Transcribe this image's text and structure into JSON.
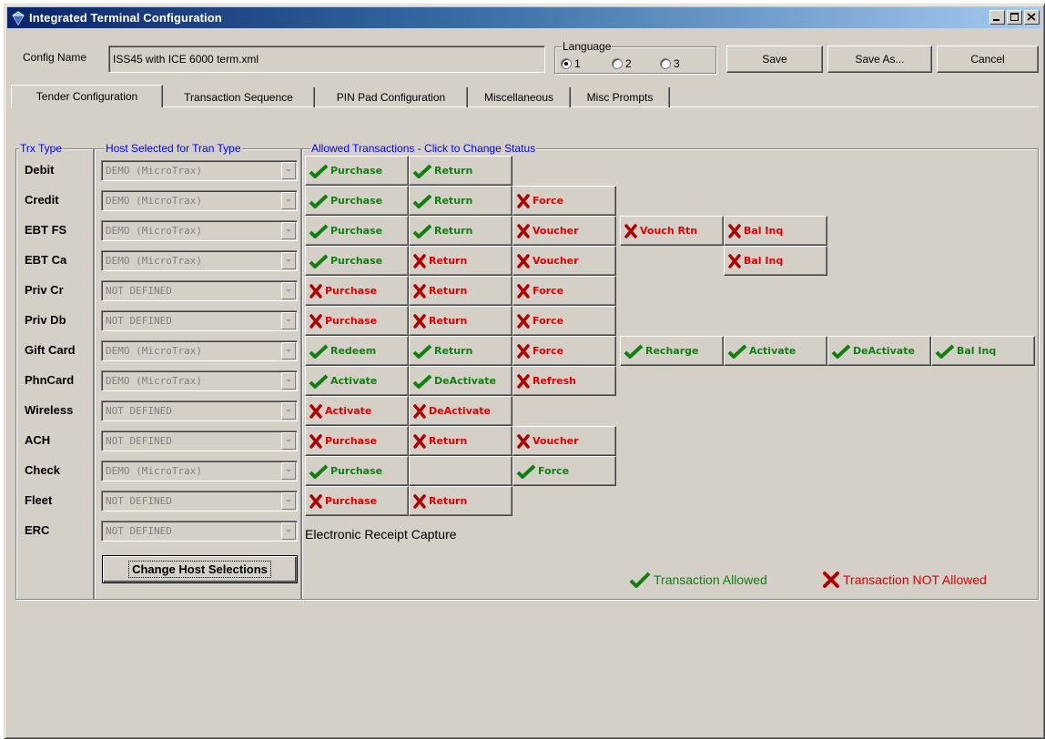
{
  "window": {
    "title": "Integrated Terminal Configuration"
  },
  "config": {
    "label": "Config Name",
    "value": "ISS45 with ICE 6000 term.xml"
  },
  "language": {
    "label": "Language",
    "options": [
      "1",
      "2",
      "3"
    ],
    "selected": "1"
  },
  "buttons": {
    "save": "Save",
    "save_as": "Save As...",
    "cancel": "Cancel",
    "change_hosts": "Change Host Selections"
  },
  "tabs": [
    "Tender Configuration",
    "Transaction Sequence",
    "PIN Pad Configuration",
    "Miscellaneous",
    "Misc Prompts"
  ],
  "active_tab": "Tender Configuration",
  "columns": {
    "trx_type": "Trx Type",
    "host": "Host Selected for Tran Type",
    "allowed": "Allowed Transactions - Click to Change Status"
  },
  "rows": [
    {
      "label": "Debit",
      "host": "DEMO (MicroTrax)",
      "trx": [
        {
          "name": "Purchase",
          "allowed": true
        },
        {
          "name": "Return",
          "allowed": true
        }
      ]
    },
    {
      "label": "Credit",
      "host": "DEMO (MicroTrax)",
      "trx": [
        {
          "name": "Purchase",
          "allowed": true
        },
        {
          "name": "Return",
          "allowed": true
        },
        {
          "name": "Force",
          "allowed": false
        }
      ]
    },
    {
      "label": "EBT FS",
      "host": "DEMO (MicroTrax)",
      "trx": [
        {
          "name": "Purchase",
          "allowed": true
        },
        {
          "name": "Return",
          "allowed": true
        },
        {
          "name": "Voucher",
          "allowed": false
        },
        {
          "name": "Vouch Rtn",
          "allowed": false
        },
        {
          "name": "Bal Inq",
          "allowed": false
        }
      ]
    },
    {
      "label": "EBT Ca",
      "host": "DEMO (MicroTrax)",
      "trx": [
        {
          "name": "Purchase",
          "allowed": true
        },
        {
          "name": "Return",
          "allowed": false
        },
        {
          "name": "Voucher",
          "allowed": false
        },
        null,
        {
          "name": "Bal Inq",
          "allowed": false
        }
      ]
    },
    {
      "label": "Priv Cr",
      "host": "NOT DEFINED",
      "trx": [
        {
          "name": "Purchase",
          "allowed": false
        },
        {
          "name": "Return",
          "allowed": false
        },
        {
          "name": "Force",
          "allowed": false
        }
      ]
    },
    {
      "label": "Priv Db",
      "host": "NOT DEFINED",
      "trx": [
        {
          "name": "Purchase",
          "allowed": false
        },
        {
          "name": "Return",
          "allowed": false
        },
        {
          "name": "Force",
          "allowed": false
        }
      ]
    },
    {
      "label": "Gift Card",
      "host": "DEMO (MicroTrax)",
      "trx": [
        {
          "name": "Redeem",
          "allowed": true
        },
        {
          "name": "Return",
          "allowed": true
        },
        {
          "name": "Force",
          "allowed": false
        },
        {
          "name": "Recharge",
          "allowed": true
        },
        {
          "name": "Activate",
          "allowed": true
        },
        {
          "name": "DeActivate",
          "allowed": true
        },
        {
          "name": "Bal Inq",
          "allowed": true
        }
      ]
    },
    {
      "label": "PhnCard",
      "host": "DEMO (MicroTrax)",
      "trx": [
        {
          "name": "Activate",
          "allowed": true
        },
        {
          "name": "DeActivate",
          "allowed": true
        },
        {
          "name": "Refresh",
          "allowed": false
        }
      ]
    },
    {
      "label": "Wireless",
      "host": "NOT DEFINED",
      "trx": [
        {
          "name": "Activate",
          "allowed": false
        },
        {
          "name": "DeActivate",
          "allowed": false
        }
      ]
    },
    {
      "label": "ACH",
      "host": "NOT DEFINED",
      "trx": [
        {
          "name": "Purchase",
          "allowed": false
        },
        {
          "name": "Return",
          "allowed": false
        },
        {
          "name": "Voucher",
          "allowed": false
        }
      ]
    },
    {
      "label": "Check",
      "host": "DEMO (MicroTrax)",
      "trx": [
        {
          "name": "Purchase",
          "allowed": true
        },
        {
          "name": "",
          "allowed": true
        },
        {
          "name": "Force",
          "allowed": true
        }
      ]
    },
    {
      "label": "Fleet",
      "host": "NOT DEFINED",
      "trx": [
        {
          "name": "Purchase",
          "allowed": false
        },
        {
          "name": "Return",
          "allowed": false
        }
      ]
    },
    {
      "label": "ERC",
      "host": "NOT DEFINED",
      "trx": []
    }
  ],
  "erc_note": "Electronic Receipt Capture",
  "legend": {
    "allowed": "Transaction Allowed",
    "not_allowed": "Transaction NOT Allowed"
  },
  "colors": {
    "allowed": "#108010",
    "not_allowed": "#e00000",
    "titlebar": "#0a246a",
    "face": "#d4d0c8",
    "column_title": "#0000ff"
  }
}
